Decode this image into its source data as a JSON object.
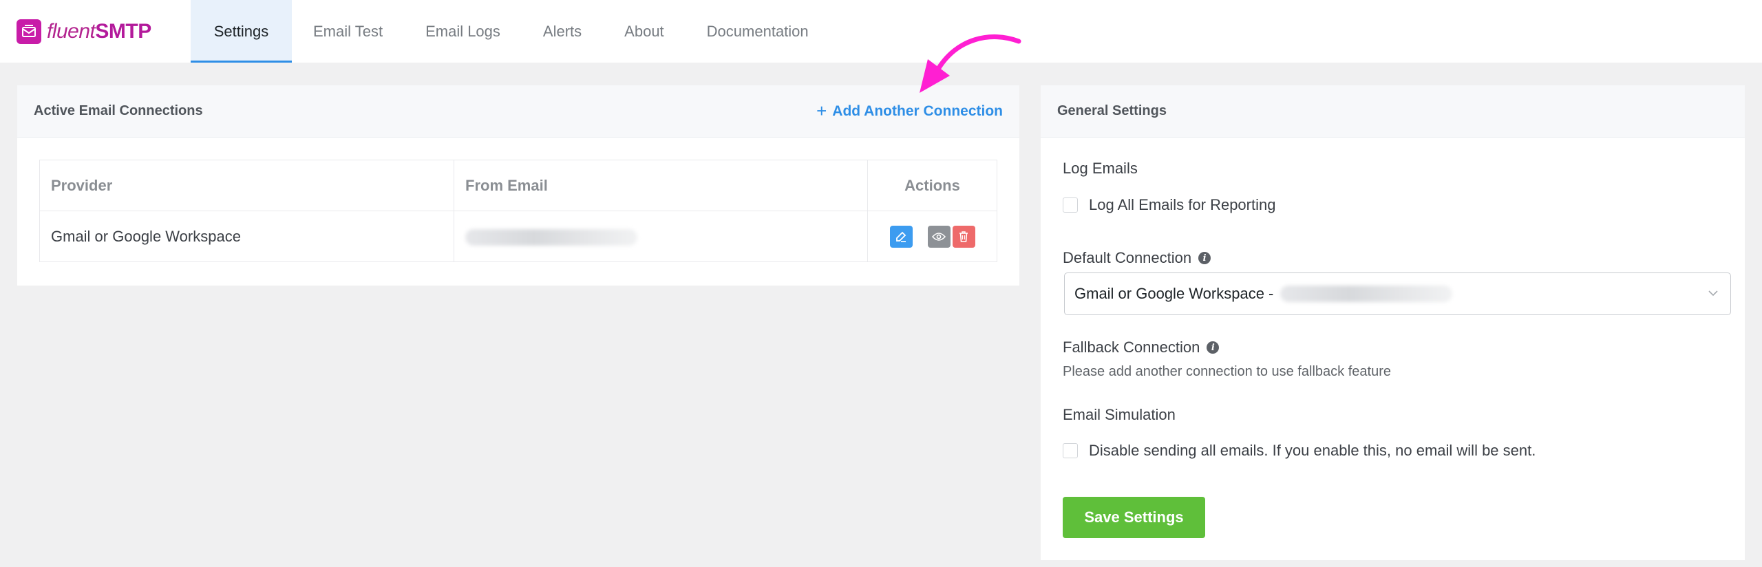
{
  "brand": {
    "name_light": "fluent",
    "name_bold": "SMTP"
  },
  "nav": {
    "tabs": [
      {
        "label": "Settings",
        "active": true
      },
      {
        "label": "Email Test"
      },
      {
        "label": "Email Logs"
      },
      {
        "label": "Alerts"
      },
      {
        "label": "About"
      },
      {
        "label": "Documentation"
      }
    ]
  },
  "connections": {
    "title": "Active Email Connections",
    "add_label": "Add Another Connection",
    "columns": [
      "Provider",
      "From Email",
      "Actions"
    ],
    "rows": [
      {
        "provider": "Gmail or Google Workspace"
      }
    ],
    "action_icons": [
      "edit-icon",
      "eye-icon",
      "trash-icon"
    ]
  },
  "general": {
    "title": "General Settings",
    "log_emails_label": "Log Emails",
    "log_all_label": "Log All Emails for Reporting",
    "default_connection_label": "Default Connection",
    "default_connection_value": "Gmail or Google Workspace -",
    "fallback_label": "Fallback Connection",
    "fallback_help": "Please add another connection to use fallback feature",
    "simulation_label": "Email Simulation",
    "simulation_option": "Disable sending all emails. If you enable this, no email will be sent.",
    "save_label": "Save Settings"
  },
  "colors": {
    "brand": "#b31a9b",
    "accent": "#2e8ee6",
    "save": "#5fbf3a",
    "delete": "#ee6a6a",
    "annotation_arrow": "#ff1fd2"
  }
}
